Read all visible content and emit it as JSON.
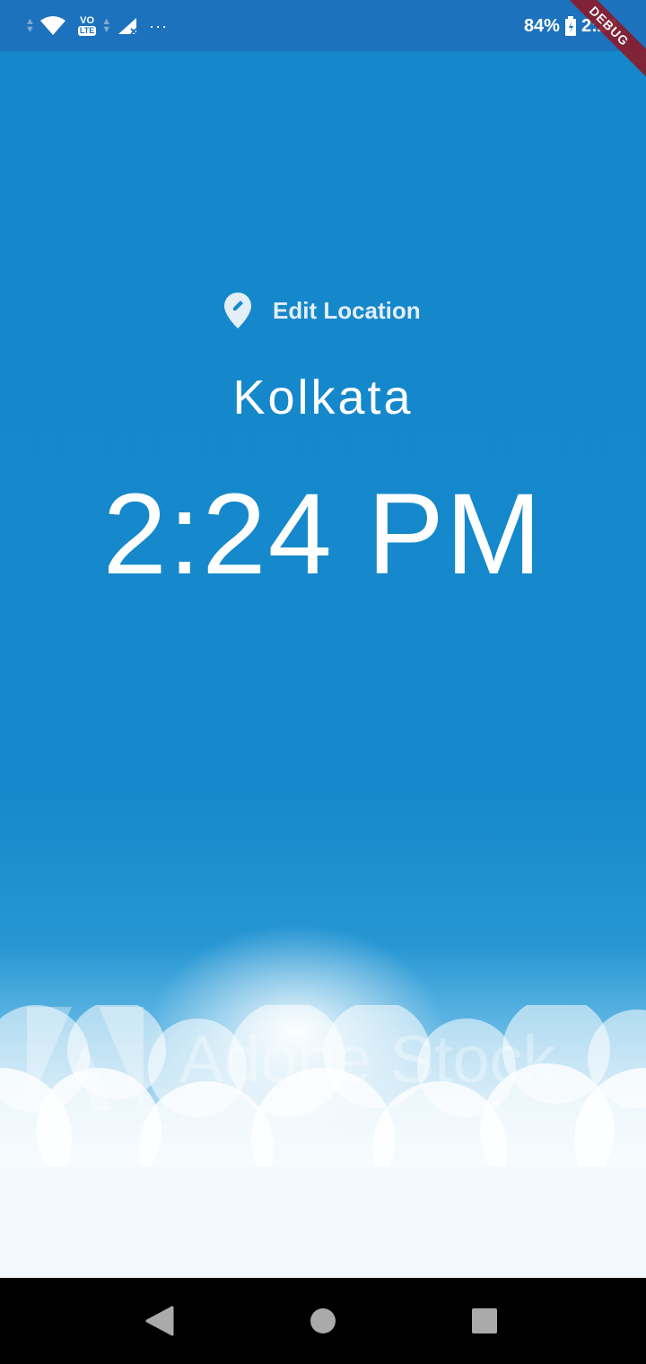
{
  "status_bar": {
    "battery": "84%",
    "time": "2:24",
    "lte_label": "LTE",
    "vo_label": "VO",
    "more": "···",
    "icons": [
      "wifi-icon",
      "volte-icon",
      "signal-icon",
      "battery-icon"
    ]
  },
  "debug_banner": "DEBUG",
  "location": {
    "edit_label": "Edit Location",
    "city": "Kolkata",
    "time": "2:24 PM"
  },
  "watermark": {
    "text": "Adobe Stock"
  },
  "colors": {
    "sky": "#1589cb",
    "status_bar": "#1c72bd",
    "text": "#ffffff",
    "debug": "#8a1c2b"
  },
  "nav": {
    "icons": [
      "back-icon",
      "home-icon",
      "recents-icon"
    ]
  }
}
